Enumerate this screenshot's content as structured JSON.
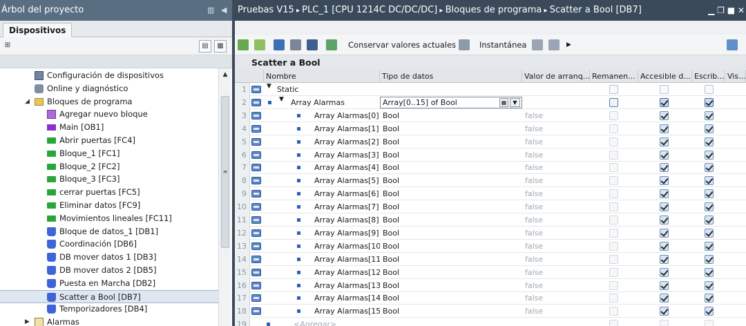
{
  "left_panel": {
    "title": "Árbol del proyecto",
    "tab": "Dispositivos",
    "tree": [
      {
        "label": "Configuración de dispositivos",
        "icon": "device-config-icon"
      },
      {
        "label": "Online y diagnóstico",
        "icon": "online-diagnostics-icon"
      },
      {
        "label": "Bloques de programa",
        "icon": "folder-icon",
        "expanded": true
      },
      {
        "label": "Agregar nuevo bloque",
        "icon": "add-block-icon"
      },
      {
        "label": "Main [OB1]",
        "icon": "ob-icon"
      },
      {
        "label": "Abrir puertas [FC4]",
        "icon": "fc-icon"
      },
      {
        "label": "Bloque_1 [FC1]",
        "icon": "fc-icon"
      },
      {
        "label": "Bloque_2 [FC2]",
        "icon": "fc-icon"
      },
      {
        "label": "Bloque_3 [FC3]",
        "icon": "fc-icon"
      },
      {
        "label": "cerrar puertas [FC5]",
        "icon": "fc-icon"
      },
      {
        "label": "Eliminar datos [FC9]",
        "icon": "fc-icon"
      },
      {
        "label": "Movimientos lineales [FC11]",
        "icon": "fc-icon"
      },
      {
        "label": "Bloque de datos_1 [DB1]",
        "icon": "db-icon"
      },
      {
        "label": "Coordinación [DB6]",
        "icon": "db-icon"
      },
      {
        "label": "DB mover datos 1 [DB3]",
        "icon": "db-icon"
      },
      {
        "label": "DB mover datos 2 [DB5]",
        "icon": "db-icon"
      },
      {
        "label": "Puesta en Marcha [DB2]",
        "icon": "db-icon"
      },
      {
        "label": "Scatter a Bool [DB7]",
        "icon": "db-icon",
        "selected": true
      },
      {
        "label": "Temporizadores [DB4]",
        "icon": "db-icon"
      },
      {
        "label": "Alarmas",
        "icon": "alarms-folder-icon",
        "collapsed": true
      }
    ]
  },
  "editor": {
    "breadcrumb": [
      "Pruebas V15",
      "PLC_1 [CPU 1214C DC/DC/DC]",
      "Bloques de programa",
      "Scatter a Bool [DB7]"
    ],
    "toolbar": {
      "keep_values_label": "Conservar valores actuales",
      "snapshot_label": "Instantánea"
    },
    "block_title": "Scatter a Bool",
    "columns": [
      "Nombre",
      "Tipo de datos",
      "Valor de arranq...",
      "Remanen...",
      "Accesible d...",
      "Escrib...",
      "Vis..."
    ],
    "rows": [
      {
        "num": "1",
        "name": "Static",
        "type": "",
        "start": "",
        "remanent": false,
        "accessible": false,
        "writable": false,
        "level": 0,
        "kind": "section"
      },
      {
        "num": "2",
        "name": "Array Alarmas",
        "type": "Array[0..15] of Bool",
        "start": "",
        "remanent": false,
        "accessible": true,
        "writable": true,
        "level": 1,
        "kind": "array"
      },
      {
        "num": "3",
        "name": "Array Alarmas[0]",
        "type": "Bool",
        "start": "false",
        "remanent": false,
        "accessible": true,
        "writable": true,
        "level": 2,
        "kind": "element"
      },
      {
        "num": "4",
        "name": "Array Alarmas[1]",
        "type": "Bool",
        "start": "false",
        "remanent": false,
        "accessible": true,
        "writable": true,
        "level": 2,
        "kind": "element"
      },
      {
        "num": "5",
        "name": "Array Alarmas[2]",
        "type": "Bool",
        "start": "false",
        "remanent": false,
        "accessible": true,
        "writable": true,
        "level": 2,
        "kind": "element"
      },
      {
        "num": "6",
        "name": "Array Alarmas[3]",
        "type": "Bool",
        "start": "false",
        "remanent": false,
        "accessible": true,
        "writable": true,
        "level": 2,
        "kind": "element"
      },
      {
        "num": "7",
        "name": "Array Alarmas[4]",
        "type": "Bool",
        "start": "false",
        "remanent": false,
        "accessible": true,
        "writable": true,
        "level": 2,
        "kind": "element"
      },
      {
        "num": "8",
        "name": "Array Alarmas[5]",
        "type": "Bool",
        "start": "false",
        "remanent": false,
        "accessible": true,
        "writable": true,
        "level": 2,
        "kind": "element"
      },
      {
        "num": "9",
        "name": "Array Alarmas[6]",
        "type": "Bool",
        "start": "false",
        "remanent": false,
        "accessible": true,
        "writable": true,
        "level": 2,
        "kind": "element"
      },
      {
        "num": "10",
        "name": "Array Alarmas[7]",
        "type": "Bool",
        "start": "false",
        "remanent": false,
        "accessible": true,
        "writable": true,
        "level": 2,
        "kind": "element"
      },
      {
        "num": "11",
        "name": "Array Alarmas[8]",
        "type": "Bool",
        "start": "false",
        "remanent": false,
        "accessible": true,
        "writable": true,
        "level": 2,
        "kind": "element"
      },
      {
        "num": "12",
        "name": "Array Alarmas[9]",
        "type": "Bool",
        "start": "false",
        "remanent": false,
        "accessible": true,
        "writable": true,
        "level": 2,
        "kind": "element"
      },
      {
        "num": "13",
        "name": "Array Alarmas[10]",
        "type": "Bool",
        "start": "false",
        "remanent": false,
        "accessible": true,
        "writable": true,
        "level": 2,
        "kind": "element"
      },
      {
        "num": "14",
        "name": "Array Alarmas[11]",
        "type": "Bool",
        "start": "false",
        "remanent": false,
        "accessible": true,
        "writable": true,
        "level": 2,
        "kind": "element"
      },
      {
        "num": "15",
        "name": "Array Alarmas[12]",
        "type": "Bool",
        "start": "false",
        "remanent": false,
        "accessible": true,
        "writable": true,
        "level": 2,
        "kind": "element"
      },
      {
        "num": "16",
        "name": "Array Alarmas[13]",
        "type": "Bool",
        "start": "false",
        "remanent": false,
        "accessible": true,
        "writable": true,
        "level": 2,
        "kind": "element"
      },
      {
        "num": "17",
        "name": "Array Alarmas[14]",
        "type": "Bool",
        "start": "false",
        "remanent": false,
        "accessible": true,
        "writable": true,
        "level": 2,
        "kind": "element"
      },
      {
        "num": "18",
        "name": "Array Alarmas[15]",
        "type": "Bool",
        "start": "false",
        "remanent": false,
        "accessible": true,
        "writable": true,
        "level": 2,
        "kind": "element"
      },
      {
        "num": "19",
        "name": "<Agregar>",
        "type": "",
        "start": "",
        "remanent": false,
        "accessible": false,
        "writable": false,
        "level": 1,
        "kind": "add"
      }
    ]
  },
  "colors": {
    "left_title_bg": "#5a6e82",
    "editor_title_bg": "#3a4a5a",
    "db_icon": "#3f63d8",
    "fc_icon": "#2aa53a",
    "ob_icon": "#8a2fd0"
  }
}
